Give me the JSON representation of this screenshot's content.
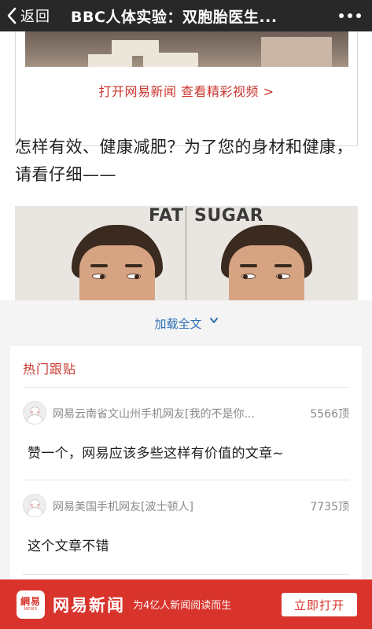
{
  "nav": {
    "back_label": "返回",
    "title": "BBC人体实验：双胞胎医生..."
  },
  "article": {
    "video_link": "打开网易新闻 查看精彩视频 >",
    "paragraph": "怎样有效、健康减肥？为了您的身材和健康，请看仔细——",
    "photo_labels": [
      "FAT",
      "SUGAR"
    ]
  },
  "load_more": {
    "label": "加载全文"
  },
  "comments": {
    "section_title": "热门跟贴",
    "items": [
      {
        "user": "网易云南省文山州手机网友[我的不是你...",
        "votes": "5566顶",
        "text": "赞一个，网易应该多些这样有价值的文章~"
      },
      {
        "user": "网易美国手机网友[波士顿人]",
        "votes": "7735顶",
        "text": "这个文章不错"
      }
    ]
  },
  "banner": {
    "logo_mark": "網易",
    "logo_sub": "NEWS",
    "brand": "网易新闻",
    "slogan": "为4亿人新闻阅读而生",
    "open_button": "立即打开"
  },
  "colors": {
    "accent_red": "#d8342c",
    "link_red": "#c8352d",
    "link_blue": "#2f6fb5",
    "topbar": "#282828"
  },
  "icons": [
    "chevron-left-icon",
    "more-dots-icon",
    "chevron-down-icon",
    "user-avatar-icon",
    "netease-news-logo"
  ]
}
